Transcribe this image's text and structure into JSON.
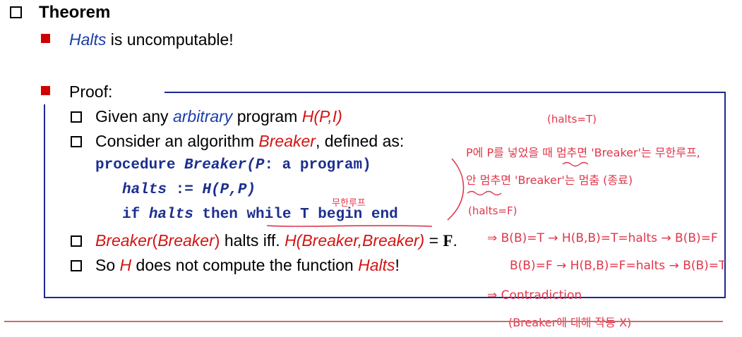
{
  "heading": {
    "title": "Theorem"
  },
  "claim": {
    "subject": "Halts",
    "rest": " is uncomputable!"
  },
  "proof": {
    "label": "Proof:"
  },
  "items": {
    "given": {
      "pre": "Given any ",
      "arbitrary": "arbitrary",
      "mid": " program ",
      "prog": "H(P,I)"
    },
    "consider": {
      "pre": "Consider an algorithm ",
      "name": "Breaker",
      "post": ", defined as:"
    },
    "code": {
      "line1_kw": "procedure ",
      "line1_name": "Breaker(",
      "line1_param": "P",
      "line1_rest": ": a program)",
      "line2_var": "halts",
      "line2_op": " := ",
      "line2_fn": "H(P,P)",
      "line3_if": "if ",
      "line3_var": "halts",
      "line3_then": " then ",
      "line3_loop": "while T begin end"
    },
    "breaker": {
      "call": "Breaker",
      "open": "(",
      "arg": "Breaker",
      "close": ")",
      "mid": " halts iff. ",
      "h": "H(Breaker,Breaker)",
      "eq": " = ",
      "f": "F",
      "dot": "."
    },
    "conclusion": {
      "pre": "So ",
      "h": "H",
      "mid": " does not compute the function ",
      "halts": "Halts",
      "end": "!"
    }
  },
  "annotations": {
    "halts_true": "(halts=T)",
    "note1": "P에 P를 넣었을 때 멈추면 'Breaker'는 무한루프,",
    "note2": "안 멈추면 'Breaker'는 멈춤 (종료)",
    "halts_false": "(halts=F)",
    "infinite_loop": "무한루프",
    "line_a": "⇒ B(B)=T → H(B,B)=T=halts → B(B)=F",
    "line_b": "B(B)=F → H(B,B)=F=halts → B(B)=T",
    "contradiction": "⇒ Contradiction",
    "not_work": "(Breaker에 대해 작동 X)"
  },
  "colors": {
    "accent_red": "#d21414",
    "code_blue": "#1c2f8f",
    "frame_blue": "#1c2a8f",
    "annotation": "#e0364a"
  }
}
